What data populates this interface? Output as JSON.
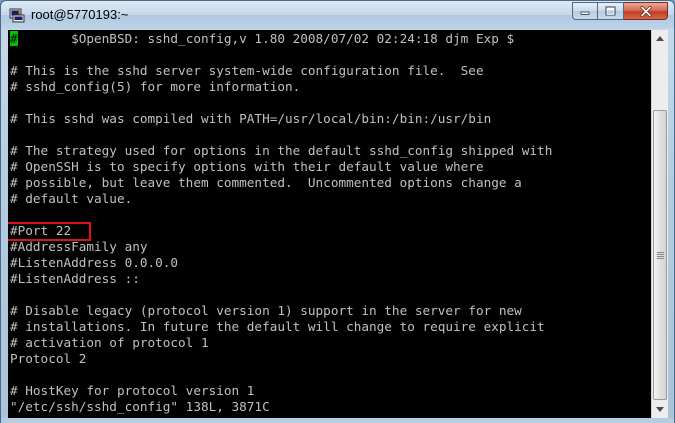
{
  "window": {
    "title": "root@5770193:~",
    "icon": "putty-icon",
    "controls": [
      "minimize-icon",
      "maximize-icon",
      "close-icon"
    ]
  },
  "terminal": {
    "cursor_char": "#",
    "lines": [
      "       $OpenBSD: sshd_config,v 1.80 2008/07/02 02:24:18 djm Exp $",
      "",
      "# This is the sshd server system-wide configuration file.  See",
      "# sshd_config(5) for more information.",
      "",
      "# This sshd was compiled with PATH=/usr/local/bin:/bin:/usr/bin",
      "",
      "# The strategy used for options in the default sshd_config shipped with",
      "# OpenSSH is to specify options with their default value where",
      "# possible, but leave them commented.  Uncommented options change a",
      "# default value.",
      "",
      "#Port 22",
      "#AddressFamily any",
      "#ListenAddress 0.0.0.0",
      "#ListenAddress ::",
      "",
      "# Disable legacy (protocol version 1) support in the server for new",
      "# installations. In future the default will change to require explicit",
      "# activation of protocol 1",
      "Protocol 2",
      "",
      "# HostKey for protocol version 1",
      "\"/etc/ssh/sshd_config\" 138L, 3871C"
    ]
  },
  "colors": {
    "terminal_bg": "#000000",
    "terminal_fg": "#c0c0c0",
    "cursor": "#00c000",
    "highlight_border": "#e0101a"
  }
}
